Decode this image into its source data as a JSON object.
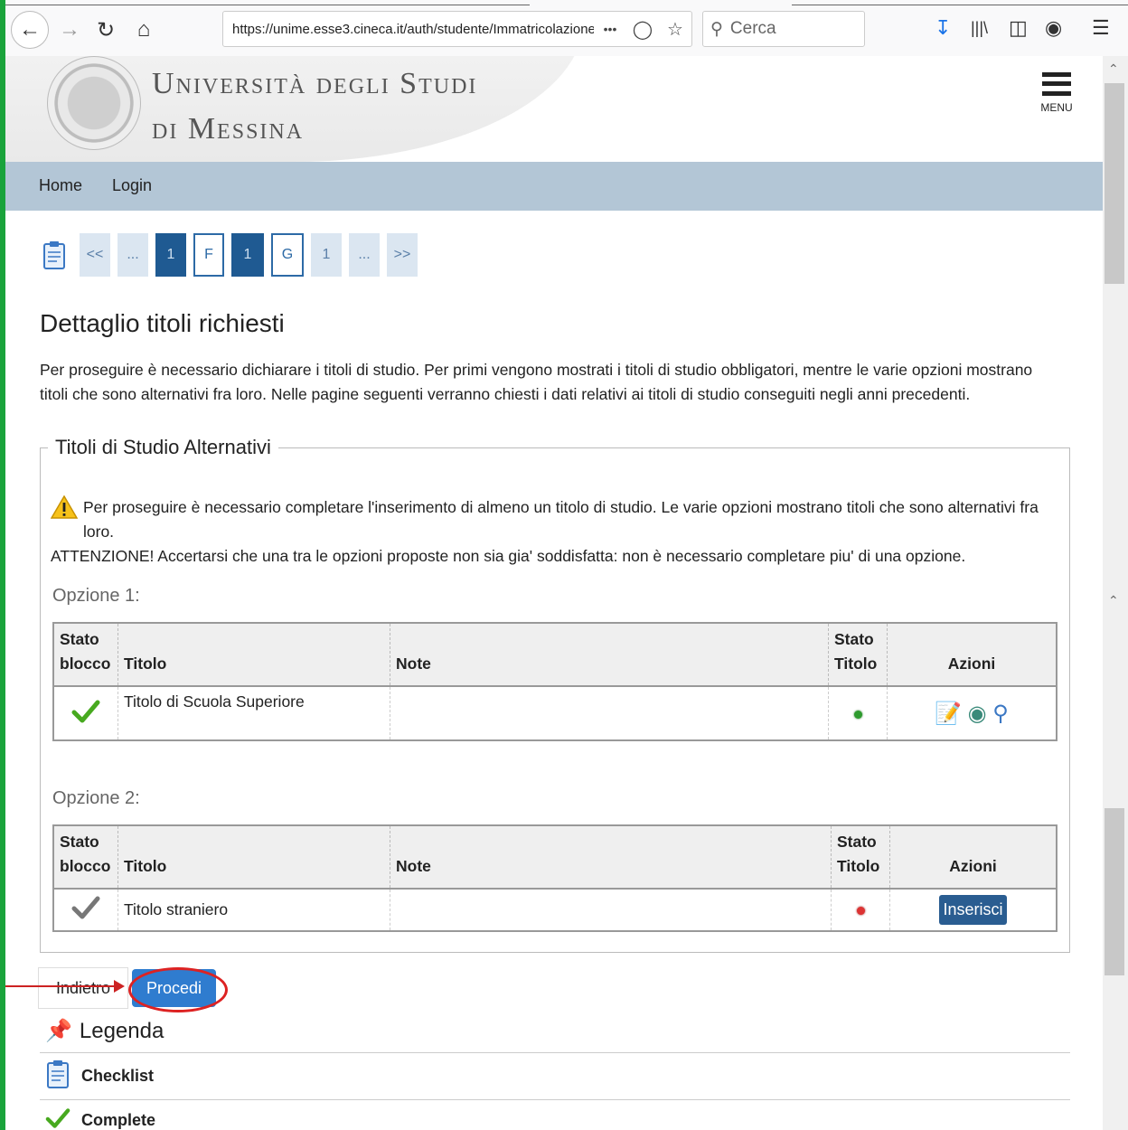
{
  "browser": {
    "url": "https://unime.esse3.cineca.it/auth/studente/Immatricolazione/",
    "search_placeholder": "Cerca",
    "more_icon": "•••"
  },
  "header": {
    "university_line1": "Università degli Studi",
    "university_line2": "di Messina",
    "menu_label": "MENU"
  },
  "nav": {
    "items": [
      "Home",
      "Login"
    ]
  },
  "pager": {
    "items": [
      "<<",
      "...",
      "1",
      "F",
      "1",
      "G",
      "1",
      "...",
      ">>"
    ]
  },
  "main": {
    "title": "Dettaglio titoli richiesti",
    "intro": "Per proseguire è necessario dichiarare i titoli di studio. Per primi vengono mostrati i titoli di studio obbligatori, mentre le varie opzioni mostrano titoli che sono alternativi fra loro. Nelle pagine seguenti verranno chiesti i dati relativi ai titoli di studio conseguiti negli anni precedenti.",
    "fieldset_legend": "Titoli di Studio Alternativi",
    "warning_text": "Per proseguire è necessario completare l'inserimento di almeno un titolo di studio. Le varie opzioni mostrano titoli che sono alternativi fra loro.",
    "attention_text": "ATTENZIONE! Accertarsi che una tra le opzioni proposte non sia gia' soddisfatta: non è necessario completare piu' di una opzione."
  },
  "table_headers": {
    "stato_blocco_1": "Stato",
    "stato_blocco_2": "blocco",
    "titolo": "Titolo",
    "note": "Note",
    "stato_titolo_1": "Stato",
    "stato_titolo_2": "Titolo",
    "azioni": "Azioni"
  },
  "options": [
    {
      "label": "Opzione 1:",
      "titolo": "Titolo di Scuola Superiore",
      "note": "",
      "status_color": "#2e9b2e"
    },
    {
      "label": "Opzione 2:",
      "titolo": "Titolo straniero",
      "note": "",
      "status_color": "#d33",
      "action_label": "Inserisci"
    }
  ],
  "buttons": {
    "back": "Indietro",
    "proceed": "Procedi"
  },
  "legend": {
    "title": "Legenda",
    "items": [
      "Checklist",
      "Complete"
    ]
  },
  "colors": {
    "nav_bg": "#b3c6d6",
    "primary_button": "#2f7ccf",
    "dark_blue": "#1f5a92",
    "annotation_red": "#d22"
  }
}
